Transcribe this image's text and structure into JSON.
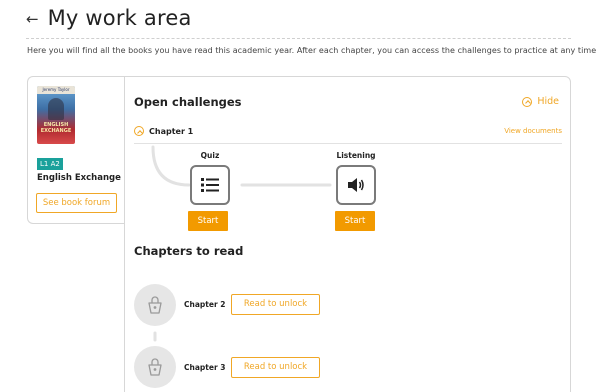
{
  "header": {
    "back_glyph": "←",
    "title": "My work area",
    "intro": "Here you will find all the books you have read this academic year. After each chapter, you can access the challenges to practice at any time!"
  },
  "book": {
    "cover_author": "Jeremy Taylor",
    "cover_title": "ENGLISH EXCHANGE",
    "level": "L1 A2",
    "title": "English Exchange",
    "forum_button": "See book forum"
  },
  "challenges": {
    "title": "Open challenges",
    "hide_label": "Hide",
    "chapter_label": "Chapter 1",
    "view_documents": "View documents",
    "activities": [
      {
        "label": "Quiz",
        "icon": "list-icon",
        "start": "Start"
      },
      {
        "label": "Listening",
        "icon": "speaker-icon",
        "start": "Start"
      }
    ]
  },
  "chapters_to_read": {
    "title": "Chapters to read",
    "items": [
      {
        "name": "Chapter 2",
        "button": "Read to unlock",
        "icon": "lock-icon"
      },
      {
        "name": "Chapter 3",
        "button": "Read to unlock",
        "icon": "lock-icon"
      }
    ]
  },
  "colors": {
    "accent": "#f29a00",
    "level_badge": "#1aa19b",
    "border": "#d7d7d7",
    "lock_bg": "#e6e6e6"
  }
}
